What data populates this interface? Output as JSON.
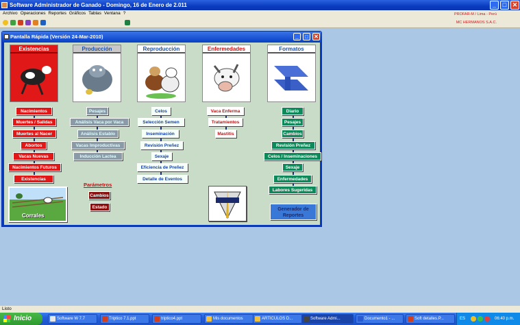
{
  "window": {
    "title": "Software Administrador de Ganado - Domingo, 16 de Enero de 2.011",
    "buttons": {
      "minimize": "_",
      "maximize": "□",
      "close": "✕"
    }
  },
  "menu": [
    "Archivo",
    "Operaciones",
    "Reportes",
    "Gráficos",
    "Tablas",
    "Ventana",
    "?"
  ],
  "toolbar": {
    "company_line1": "PROFAR-M / Lima - Perú",
    "company_line2": "MC HERMANOS S.A.C."
  },
  "child": {
    "title": "Pantalla Rápida (Versión 24-Mar-2010)"
  },
  "sections": {
    "existencias": {
      "header": "Existencias",
      "items": [
        "Nacimientos",
        "Muertes / Salidas",
        "Muertes al Nacer",
        "Abortos",
        "Vacas Nuevas",
        "Nacimientos Futuros",
        "Existencias"
      ]
    },
    "produccion": {
      "header": "Producción",
      "items": [
        "Pesajes",
        "Análisis Vaca por Vaca",
        "Análisis Establo",
        "Vacas Improductivas",
        "Inducción Lactea"
      ]
    },
    "reproduccion": {
      "header": "Reproducción",
      "items": [
        "Celos",
        "Selección Semen",
        "Inseminación",
        "Revisión Preñez",
        "Sexaje",
        "Eficiencia de Preñez",
        "Detalle de Eventos"
      ]
    },
    "enfermedades": {
      "header": "Enfermedades",
      "items": [
        "Vaca Enferma",
        "Tratamientos",
        "Mastitis"
      ]
    },
    "formatos": {
      "header": "Formatos",
      "items": [
        "Diario",
        "Pesajes",
        "Cambios",
        "Revisión Preñez",
        "Celos / Inseminaciones",
        "Sexaje",
        "Enfermedades",
        "Labores Sugeridas"
      ]
    }
  },
  "parametros": {
    "label": "Parámetros",
    "items": [
      "Cambios",
      "Estado"
    ]
  },
  "corrales": {
    "label": "Corrales"
  },
  "generador": {
    "label": "Generador de Reportes"
  },
  "status": {
    "text": "Listo"
  },
  "taskbar": {
    "start": "Inicio",
    "tasks": [
      "Software W 7.7",
      "Triptico 7.1.ppt",
      "triptico4.ppt",
      "Mis documentos",
      "ARTICULOS D...",
      "Software Admi...",
      "Documento1 - ...",
      "Soft detalles.P..."
    ],
    "active_index": 5,
    "lang": "ES",
    "clock": "06:40 p.m."
  },
  "colors": {
    "existencias": "#e01818",
    "produccion_header": "#1f4fa0",
    "reproduccion_header": "#1f4fa0",
    "enfermedades_header": "#d01010",
    "formatos_header": "#1f4fa0",
    "body": "#c8dcc8",
    "mdi": "#aac8e6"
  }
}
